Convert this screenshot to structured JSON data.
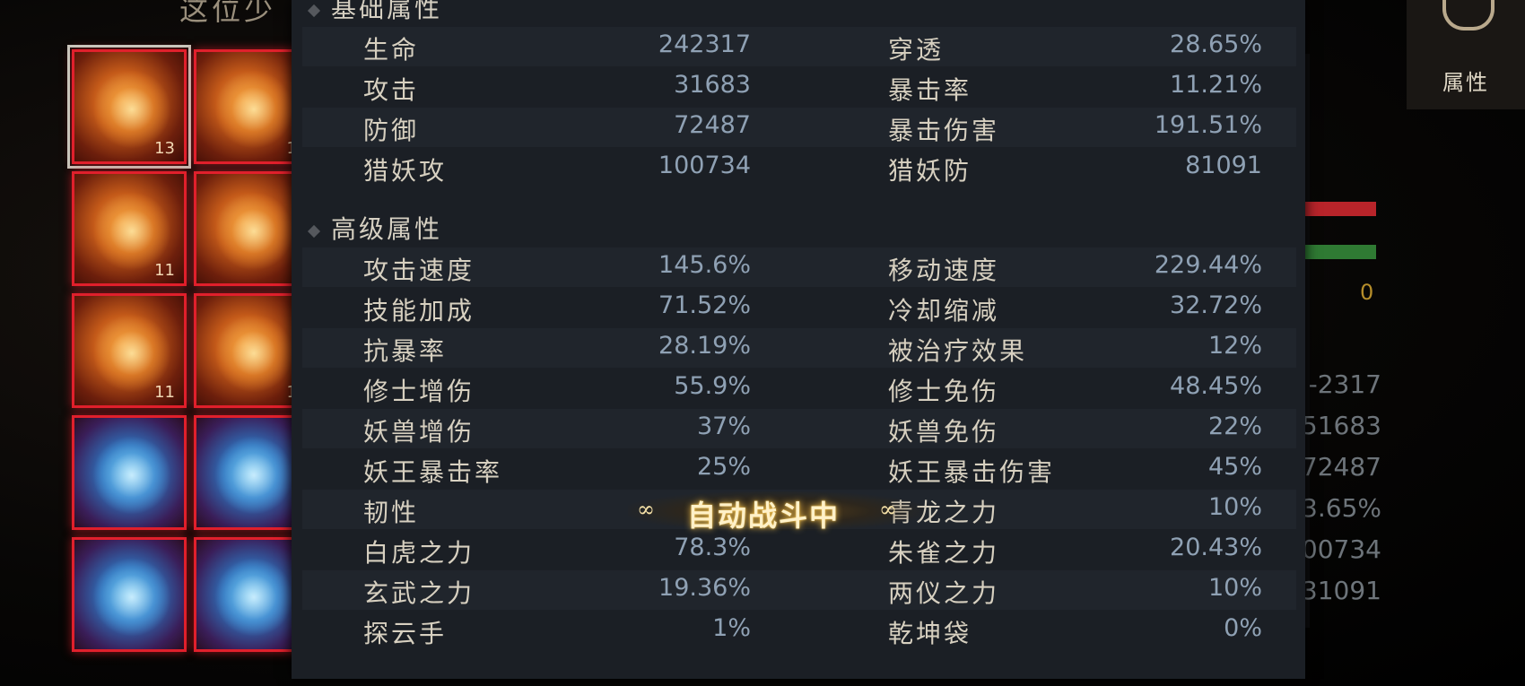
{
  "background": {
    "top_left_title": "这位少",
    "right_panel": {
      "zero_value": "0",
      "partial_values": [
        "-2317",
        "51683",
        "72487",
        "3.65%",
        "00734",
        "31091"
      ]
    },
    "side_tab": {
      "label": "属性"
    }
  },
  "equipment": {
    "slots": [
      {
        "color": "orange",
        "level": "13",
        "icon": "sword-icon",
        "selected": true
      },
      {
        "color": "orange",
        "level": "1",
        "icon": "armor-icon"
      },
      {
        "color": "orange",
        "level": "11",
        "icon": "amulet-icon"
      },
      {
        "color": "orange",
        "level": "",
        "icon": "robe-icon"
      },
      {
        "color": "orange",
        "level": "11",
        "icon": "ring-icon"
      },
      {
        "color": "orange",
        "level": "1",
        "icon": "bracer-icon"
      },
      {
        "color": "blue",
        "level": "",
        "icon": "boots-icon"
      },
      {
        "color": "blue",
        "level": "",
        "icon": "wing-icon"
      },
      {
        "color": "blue",
        "level": "",
        "icon": "flower-icon"
      },
      {
        "color": "blue",
        "level": "",
        "icon": "orb-icon"
      }
    ]
  },
  "tooltip": {
    "basic_header": "基础属性",
    "basic": [
      {
        "k1": "生命",
        "v1": "242317",
        "k2": "穿透",
        "v2": "28.65%"
      },
      {
        "k1": "攻击",
        "v1": "31683",
        "k2": "暴击率",
        "v2": "11.21%"
      },
      {
        "k1": "防御",
        "v1": "72487",
        "k2": "暴击伤害",
        "v2": "191.51%"
      },
      {
        "k1": "猎妖攻",
        "v1": "100734",
        "k2": "猎妖防",
        "v2": "81091"
      }
    ],
    "advanced_header": "高级属性",
    "advanced": [
      {
        "k1": "攻击速度",
        "v1": "145.6%",
        "k2": "移动速度",
        "v2": "229.44%"
      },
      {
        "k1": "技能加成",
        "v1": "71.52%",
        "k2": "冷却缩减",
        "v2": "32.72%"
      },
      {
        "k1": "抗暴率",
        "v1": "28.19%",
        "k2": "被治疗效果",
        "v2": "12%"
      },
      {
        "k1": "修士增伤",
        "v1": "55.9%",
        "k2": "修士免伤",
        "v2": "48.45%"
      },
      {
        "k1": "妖兽增伤",
        "v1": "37%",
        "k2": "妖兽免伤",
        "v2": "22%"
      },
      {
        "k1": "妖王暴击率",
        "v1": "25%",
        "k2": "妖王暴击伤害",
        "v2": "45%"
      },
      {
        "k1": "韧性",
        "v1": "",
        "k2": "青龙之力",
        "v2": "10%"
      },
      {
        "k1": "白虎之力",
        "v1": "78.3%",
        "k2": "朱雀之力",
        "v2": "20.43%"
      },
      {
        "k1": "玄武之力",
        "v1": "19.36%",
        "k2": "两仪之力",
        "v2": "10%"
      },
      {
        "k1": "探云手",
        "v1": "1%",
        "k2": "乾坤袋",
        "v2": "0%"
      }
    ]
  },
  "auto_battle": {
    "label": "自动战斗中",
    "ornament": "∞"
  }
}
